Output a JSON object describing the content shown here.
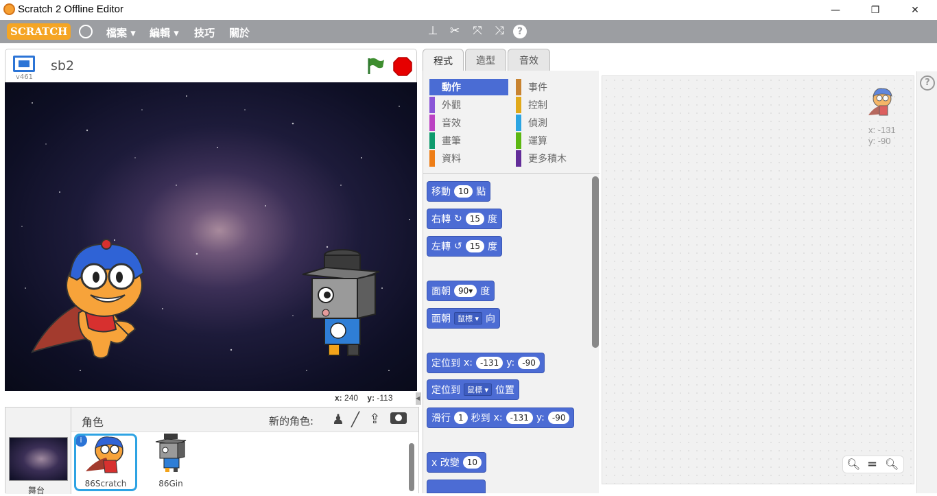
{
  "window": {
    "title": "Scratch 2 Offline Editor",
    "minimize": "—",
    "maximize": "❐",
    "close": "✕"
  },
  "menubar": {
    "logo": "SCRATCH",
    "menus": [
      "檔案 ▾",
      "編輯 ▾",
      "技巧",
      "關於"
    ],
    "tools": [
      "duplicate-stamp",
      "delete-cut",
      "grow",
      "shrink",
      "help"
    ]
  },
  "stage": {
    "project_name": "sb2",
    "version": "v461",
    "coords": {
      "x_label": "x:",
      "x": "240",
      "y_label": "y:",
      "y": "-113"
    }
  },
  "sprites": {
    "header": "角色",
    "new_sprite_label": "新的角色:",
    "stage_label": "舞台",
    "items": [
      {
        "name": "86Scratch",
        "selected": true
      },
      {
        "name": "86Gin",
        "selected": false
      }
    ]
  },
  "tabs": [
    "程式",
    "造型",
    "音效"
  ],
  "categories": {
    "left": [
      {
        "label": "動作",
        "color": "#4a6cd4",
        "active": true
      },
      {
        "label": "外觀",
        "color": "#8a55d7"
      },
      {
        "label": "音效",
        "color": "#bb42c3"
      },
      {
        "label": "畫筆",
        "color": "#0e9a6c"
      },
      {
        "label": "資料",
        "color": "#ee7d16"
      }
    ],
    "right": [
      {
        "label": "事件",
        "color": "#c88330"
      },
      {
        "label": "控制",
        "color": "#e1a91a"
      },
      {
        "label": "偵測",
        "color": "#2ca5e2"
      },
      {
        "label": "運算",
        "color": "#5cb712"
      },
      {
        "label": "更多積木",
        "color": "#632d99"
      }
    ]
  },
  "blocks": {
    "move": {
      "a": "移動",
      "n": "10",
      "b": "點"
    },
    "turn_right": {
      "a": "右轉",
      "n": "15",
      "b": "度"
    },
    "turn_left": {
      "a": "左轉",
      "n": "15",
      "b": "度"
    },
    "point_dir": {
      "a": "面朝",
      "n": "90▾",
      "b": "度"
    },
    "point_towards": {
      "a": "面朝",
      "d": "鼠標",
      "b": "向"
    },
    "goto_xy": {
      "a": "定位到",
      "xl": "x:",
      "x": "-131",
      "yl": "y:",
      "y": "-90"
    },
    "goto": {
      "a": "定位到",
      "d": "鼠標",
      "b": "位置"
    },
    "glide": {
      "a": "滑行",
      "s": "1",
      "b": "秒到",
      "xl": "x:",
      "x": "-131",
      "yl": "y:",
      "y": "-90"
    },
    "change_x": {
      "a": "x 改變",
      "n": "10"
    }
  },
  "scripts_area": {
    "sprite_x": "x: -131",
    "sprite_y": "y: -90",
    "help": "?"
  }
}
